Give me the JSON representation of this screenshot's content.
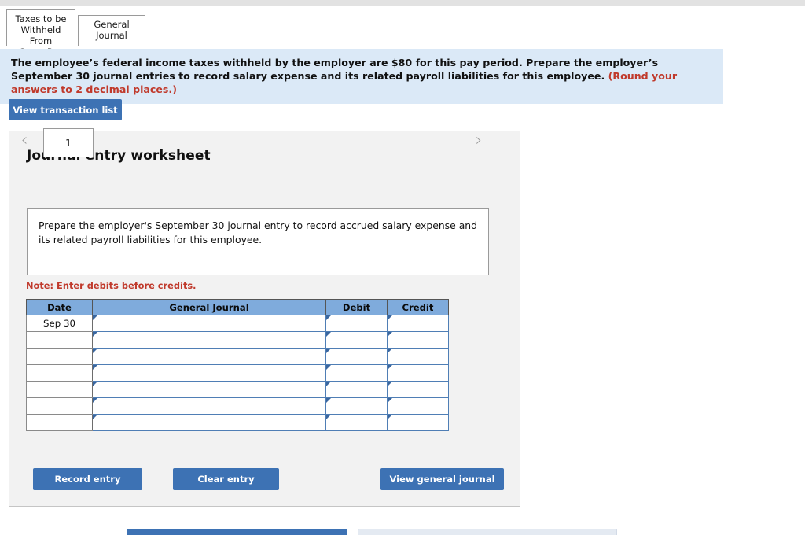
{
  "tabs": [
    {
      "label": "Taxes to be\nWithheld From\nGross Pay",
      "active": false
    },
    {
      "label": "General\nJournal",
      "active": true
    }
  ],
  "banner": {
    "text": "The employee’s federal income taxes withheld by the employer are $80 for this pay period. Prepare the employer’s September 30 journal entries to record salary expense and its related payroll liabilities for this employee. ",
    "note": "(Round your answers to 2 decimal places.)"
  },
  "toolbar": {
    "view_transaction_list_label": "View transaction list"
  },
  "worksheet": {
    "title": "Journal entry worksheet",
    "prev_icon": "chevron-left-icon",
    "next_icon": "chevron-right-icon",
    "page_tab_label": "1",
    "prompt": "Prepare the employer's September 30 journal entry to record accrued salary expense and its related payroll liabilities for this employee.",
    "note": "Note: Enter debits before credits.",
    "table": {
      "columns": [
        "Date",
        "General Journal",
        "Debit",
        "Credit"
      ],
      "rows": [
        {
          "date": "Sep 30",
          "general_journal": "",
          "debit": "",
          "credit": ""
        },
        {
          "date": "",
          "general_journal": "",
          "debit": "",
          "credit": ""
        },
        {
          "date": "",
          "general_journal": "",
          "debit": "",
          "credit": ""
        },
        {
          "date": "",
          "general_journal": "",
          "debit": "",
          "credit": ""
        },
        {
          "date": "",
          "general_journal": "",
          "debit": "",
          "credit": ""
        },
        {
          "date": "",
          "general_journal": "",
          "debit": "",
          "credit": ""
        },
        {
          "date": "",
          "general_journal": "",
          "debit": "",
          "credit": ""
        }
      ]
    },
    "actions": {
      "record_entry_label": "Record entry",
      "clear_entry_label": "Clear entry",
      "view_general_journal_label": "View general journal"
    }
  },
  "colors": {
    "accent_blue": "#3d72b4",
    "table_header_blue": "#7fabdc",
    "banner_blue": "#dbe9f7",
    "panel_gray": "#f2f2f2",
    "note_red": "#c0392b"
  }
}
